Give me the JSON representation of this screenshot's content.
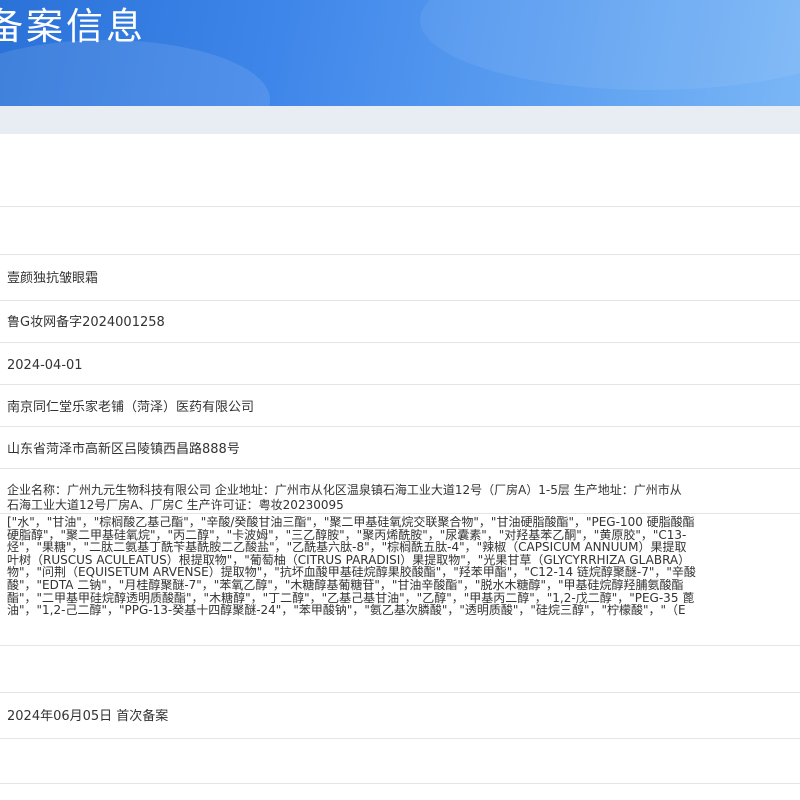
{
  "header": {
    "title": "备案信息"
  },
  "record": {
    "product_name": "壹颜独抗皱眼霜",
    "record_number": "鲁G妆网备字2024001258",
    "record_date": "2024-04-01",
    "registrant": "南京同仁堂乐家老铺（菏泽）医药有限公司",
    "registrant_address": "山东省菏泽市高新区吕陵镇西昌路888号",
    "manufacturer_line1": "企业名称：广州九元生物科技有限公司 企业地址：广州市从化区温泉镇石海工业大道12号（厂房A）1-5层 生产地址：广州市从",
    "manufacturer_line2": "石海工业大道12号厂房A、厂房C 生产许可证：粤妆20230095",
    "ingredients_lines": [
      "[\"水\"，\"甘油\"，\"棕榈酸乙基己酯\"，\"辛酸/癸酸甘油三酯\"，\"聚二甲基硅氧烷交联聚合物\"，\"甘油硬脂酸酯\"，\"PEG-100 硬脂酸酯",
      "硬脂醇\"，\"聚二甲基硅氧烷\"，\"丙二醇\"，\"卡波姆\"，\"三乙醇胺\"，\"聚丙烯酰胺\"，\"尿囊素\"，\"对羟基苯乙酮\"，\"黄原胶\"，\"C13-",
      "烃\"，\"果糖\"，\"二肽二氨基丁酰苄基酰胺二乙酸盐\"，\"乙酰基六肽-8\"，\"棕榈酰五肽-4\"，\"辣椒（CAPSICUM ANNUUM）果提取",
      "叶树（RUSCUS ACULEATUS）根提取物\"，\"葡萄柚（CITRUS PARADISI）果提取物\"，\"光果甘草（GLYCYRRHIZA GLABRA）",
      "物\"，\"问荆（EQUISETUM ARVENSE）提取物\"，\"抗坏血酸甲基硅烷醇果胶酸酯\"，\"羟苯甲酯\"，\"C12-14 链烷醇聚醚-7\"，\"辛酸",
      "酸\"，\"EDTA 二钠\"，\"月桂醇聚醚-7\"，\"苯氧乙醇\"，\"木糖醇基葡糖苷\"，\"甘油辛酸酯\"，\"脱水木糖醇\"，\"甲基硅烷醇羟脯氨酸酯",
      "酯\"，\"二甲基甲硅烷醇透明质酸酯\"，\"木糖醇\"，\"丁二醇\"，\"乙基己基甘油\"，\"乙醇\"，\"甲基丙二醇\"，\"1,2-戊二醇\"，\"PEG-35 蓖",
      "油\"，\"1,2-己二醇\"，\"PPG-13-癸基十四醇聚醚-24\"，\"苯甲酸钠\"，\"氨乙基次膦酸\"，\"透明质酸\"，\"硅烷三醇\"，\"柠檬酸\"，\"（E"
    ],
    "status": "2024年06月05日 首次备案"
  },
  "colors": {
    "banner_start": "#2a72d8",
    "banner_end": "#7ab6f6",
    "subbar": "#e8edf3",
    "divider": "#e1e5ea",
    "text": "#333333"
  }
}
